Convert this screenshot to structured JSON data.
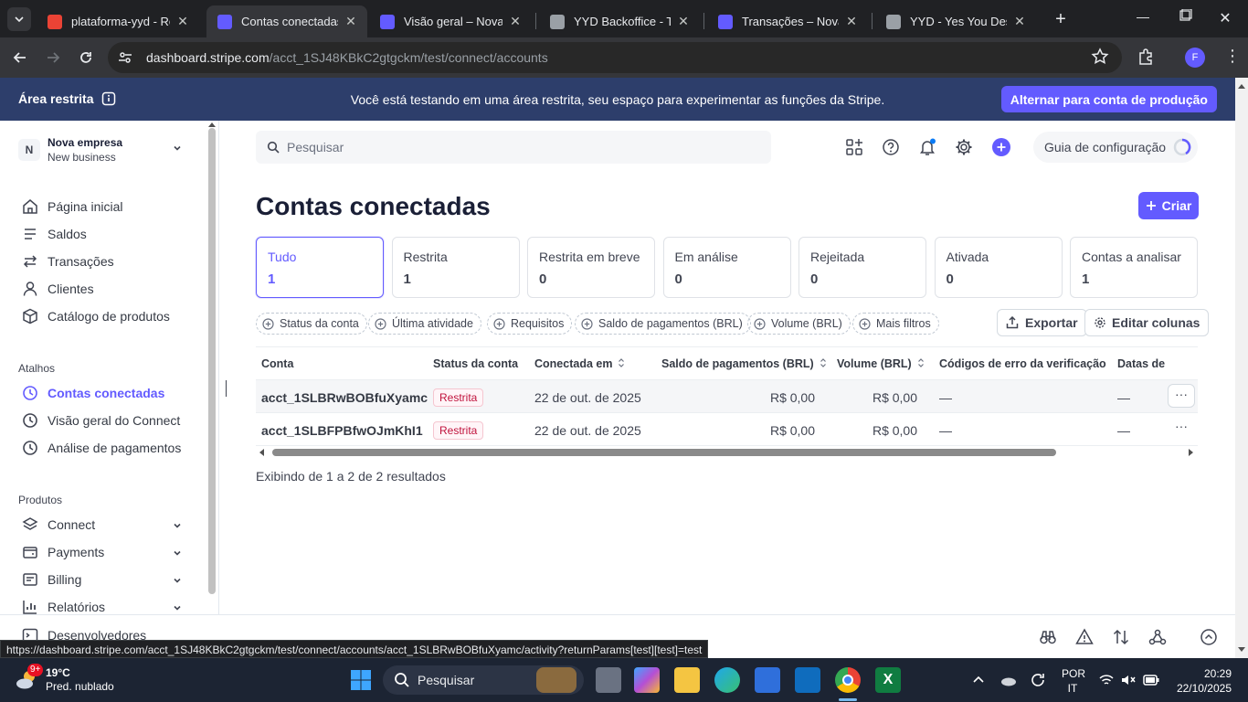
{
  "browser": {
    "tabs": [
      {
        "title": "plataforma-yyd - Rep",
        "color": "#ea4335",
        "active": false
      },
      {
        "title": "Contas conectadas – ",
        "color": "#635bff",
        "active": true
      },
      {
        "title": "Visão geral – Nova em",
        "color": "#635bff",
        "active": false
      },
      {
        "title": "YYD Backoffice - Tour",
        "color": "#9aa0a6",
        "active": false
      },
      {
        "title": "Transações – Nova em",
        "color": "#635bff",
        "active": false
      },
      {
        "title": "YYD - Yes You Deserv",
        "color": "#9aa0a6",
        "active": false
      }
    ],
    "url_host": "dashboard.stripe.com",
    "url_path": "/acct_1SJ48KBkC2gtgckm/test/connect/accounts",
    "profile_initial": "F"
  },
  "banner": {
    "left_label": "Área restrita",
    "message": "Você está testando em uma área restrita, seu espaço para experimentar as funções da Stripe.",
    "prod_button": "Alternar para conta de produção"
  },
  "sidebar": {
    "account_initial": "N",
    "account_name": "Nova empresa",
    "account_sub": "New business",
    "main_items": [
      {
        "label": "Página inicial",
        "icon": "home-icon"
      },
      {
        "label": "Saldos",
        "icon": "balance-icon"
      },
      {
        "label": "Transações",
        "icon": "arrows-icon"
      },
      {
        "label": "Clientes",
        "icon": "person-icon"
      },
      {
        "label": "Catálogo de produtos",
        "icon": "box-icon"
      }
    ],
    "shortcuts_header": "Atalhos",
    "shortcuts": [
      {
        "label": "Contas conectadas",
        "icon": "clock-icon",
        "active": true
      },
      {
        "label": "Visão geral do Connect",
        "icon": "clock-icon",
        "active": false
      },
      {
        "label": "Análise de pagamentos",
        "icon": "clock-icon",
        "active": false
      }
    ],
    "products_header": "Produtos",
    "products": [
      {
        "label": "Connect",
        "icon": "layers-icon"
      },
      {
        "label": "Payments",
        "icon": "wallet-icon"
      },
      {
        "label": "Billing",
        "icon": "receipt-icon"
      },
      {
        "label": "Relatórios",
        "icon": "chart-icon"
      }
    ],
    "developers": "Desenvolvedores"
  },
  "topbar": {
    "search_placeholder": "Pesquisar",
    "guide": "Guia de configuração"
  },
  "page": {
    "title": "Contas conectadas",
    "create_button": "Criar",
    "status_cards": [
      {
        "label": "Tudo",
        "value": "1",
        "active": true
      },
      {
        "label": "Restrita",
        "value": "1",
        "active": false
      },
      {
        "label": "Restrita em breve",
        "value": "0",
        "active": false
      },
      {
        "label": "Em análise",
        "value": "0",
        "active": false
      },
      {
        "label": "Rejeitada",
        "value": "0",
        "active": false
      },
      {
        "label": "Ativada",
        "value": "0",
        "active": false
      },
      {
        "label": "Contas a analisar",
        "value": "1",
        "active": false
      }
    ],
    "filters": [
      "Status da conta",
      "Última atividade",
      "Requisitos",
      "Saldo de pagamentos (BRL)",
      "Volume (BRL)",
      "Mais filtros"
    ],
    "export_button": "Exportar",
    "edit_columns_button": "Editar colunas",
    "table": {
      "columns": [
        "Conta",
        "Status da conta",
        "Conectada em",
        "Saldo de pagamentos (BRL)",
        "Volume (BRL)",
        "Códigos de erro da verificação",
        "Datas de"
      ],
      "rows": [
        {
          "account": "acct_1SLBRwBOBfuXyamc",
          "status": "Restrita",
          "connected": "22 de out. de 2025",
          "balance": "R$ 0,00",
          "volume": "R$ 0,00",
          "errors": "—",
          "dates": "—"
        },
        {
          "account": "acct_1SLBFPBfwOJmKhI1",
          "status": "Restrita",
          "connected": "22 de out. de 2025",
          "balance": "R$ 0,00",
          "volume": "R$ 0,00",
          "errors": "—",
          "dates": "—"
        }
      ]
    },
    "results_text": "Exibindo de 1 a 2 de 2 resultados"
  },
  "status_url": "https://dashboard.stripe.com/acct_1SJ48KBkC2gtgckm/test/connect/accounts/acct_1SLBRwBOBfuXyamc/activity?returnParams[test][test]=test",
  "taskbar": {
    "weather_temp": "19°C",
    "weather_desc": "Pred. nublado",
    "weather_badge": "9+",
    "search": "Pesquisar",
    "lang_top": "POR",
    "lang_bottom": "IT",
    "time": "20:29",
    "date": "22/10/2025"
  }
}
